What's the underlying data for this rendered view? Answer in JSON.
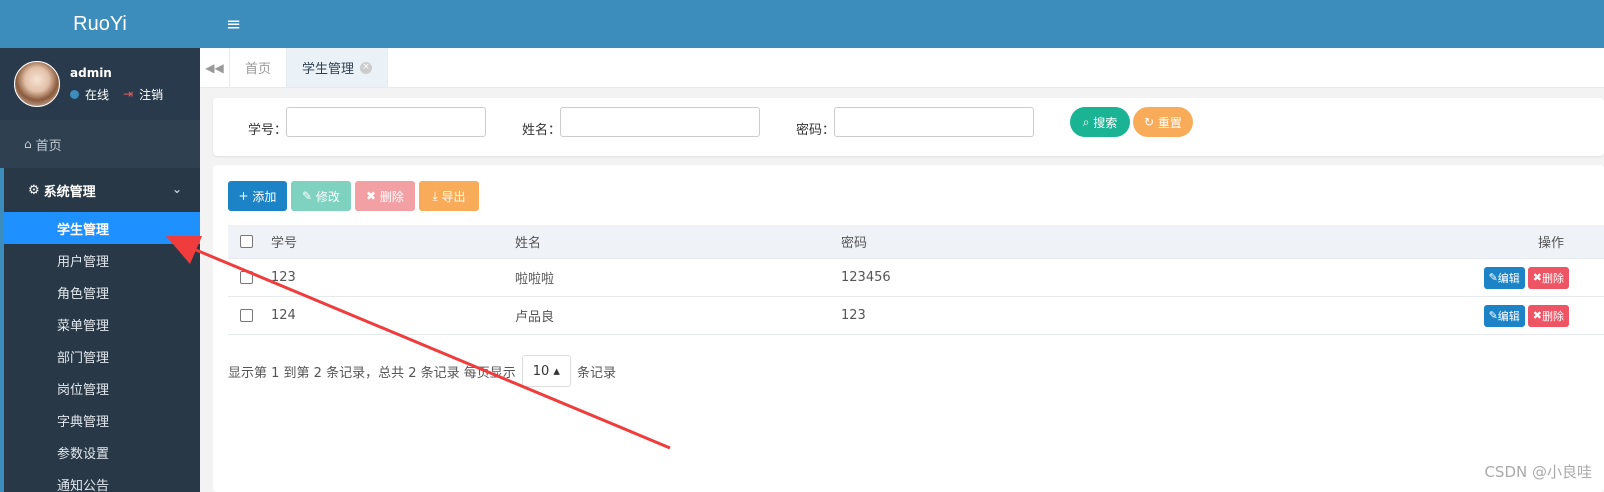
{
  "app": {
    "brand": "RuoYi"
  },
  "user": {
    "name": "admin",
    "status": "在线",
    "logout": "注销"
  },
  "nav": {
    "home": "首页",
    "group": "系统管理",
    "items": [
      {
        "label": "学生管理",
        "active": true
      },
      {
        "label": "用户管理"
      },
      {
        "label": "角色管理"
      },
      {
        "label": "菜单管理"
      },
      {
        "label": "部门管理"
      },
      {
        "label": "岗位管理"
      },
      {
        "label": "字典管理"
      },
      {
        "label": "参数设置"
      },
      {
        "label": "通知公告"
      }
    ]
  },
  "tabs": [
    {
      "label": "首页"
    },
    {
      "label": "学生管理",
      "active": true
    }
  ],
  "search": {
    "fields": [
      {
        "label": "学号："
      },
      {
        "label": "姓名："
      },
      {
        "label": "密码："
      }
    ],
    "search_label": "搜索",
    "reset_label": "重置"
  },
  "toolbar": {
    "add": "添加",
    "edit": "修改",
    "delete": "删除",
    "export": "导出"
  },
  "table": {
    "columns": {
      "no": "学号",
      "name": "姓名",
      "password": "密码",
      "ops": "操作"
    },
    "rows": [
      {
        "no": "123",
        "name": "啦啦啦",
        "password": "123456"
      },
      {
        "no": "124",
        "name": "卢品良",
        "password": "123"
      }
    ],
    "edit": "编辑",
    "delete": "删除"
  },
  "pager": {
    "summary": "显示第 1 到第 2 条记录，总共 2 条记录 每页显示",
    "page_size": "10",
    "suffix": "条记录"
  },
  "watermark": "CSDN @小良哇",
  "colors": {
    "brand": "#3c8dbc",
    "sidebar": "#2f4050",
    "active": "#1e90ff",
    "annotation": "#f03c3c"
  }
}
